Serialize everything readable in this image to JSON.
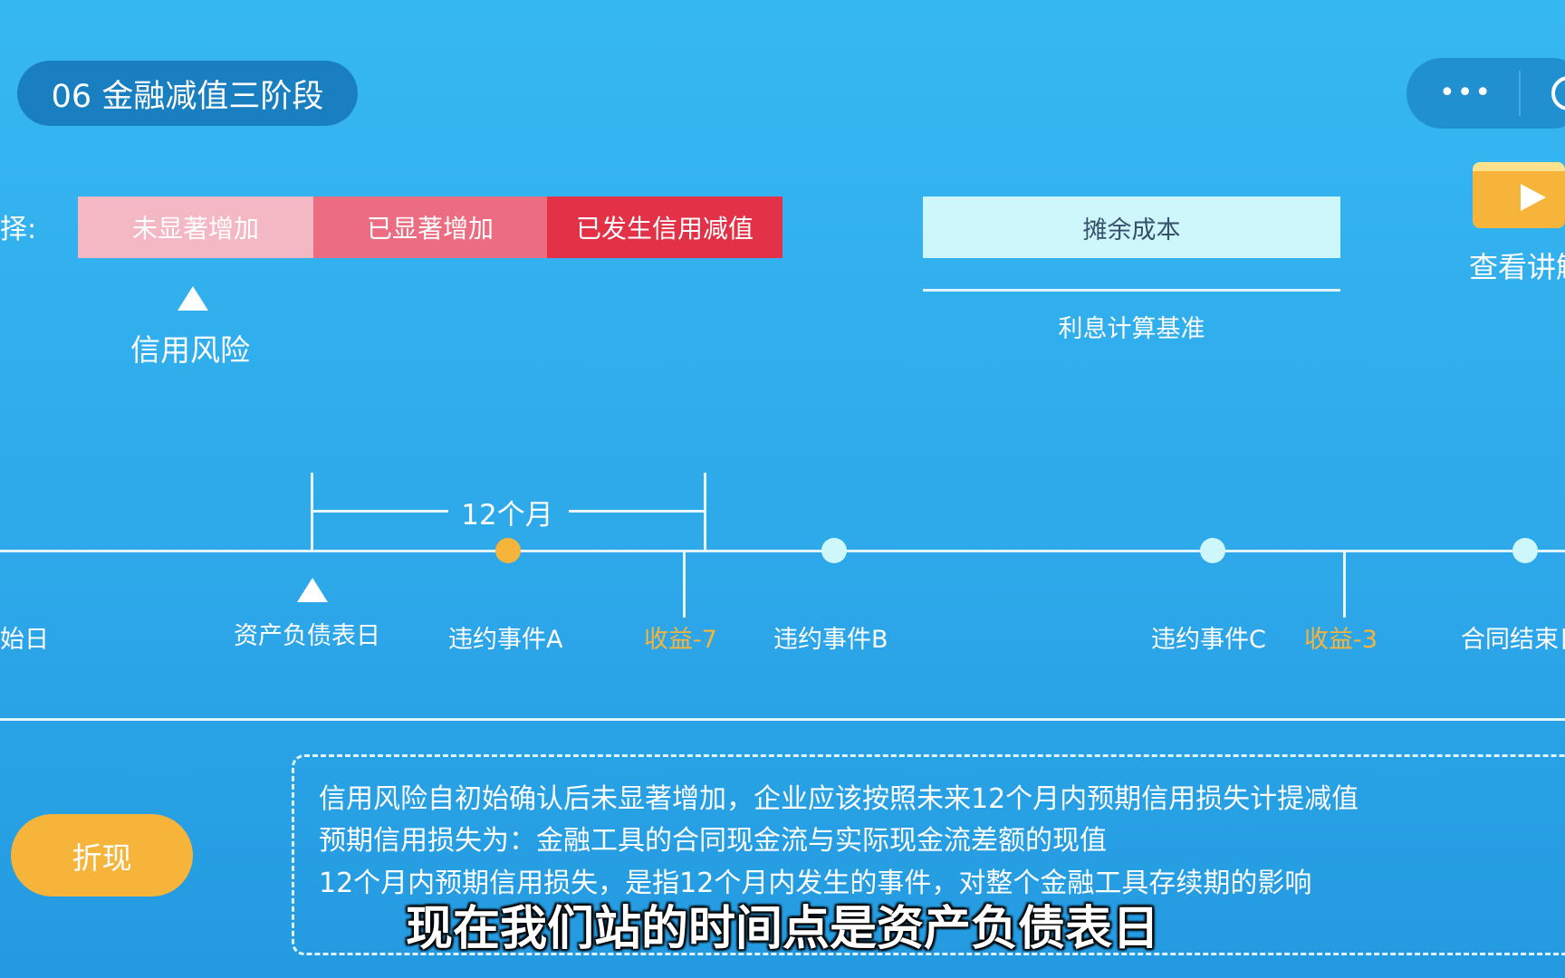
{
  "header": {
    "title": "06 金融减值三阶段"
  },
  "capsule": {
    "dots": "•••"
  },
  "selection": {
    "label": "选择:",
    "stages": [
      "未显著增加",
      "已显著增加",
      "已发生信用减值"
    ]
  },
  "credit_risk_label": "信用风险",
  "amortized": {
    "cost_label": "摊余成本",
    "interest_basis_label": "利息计算基准"
  },
  "video": {
    "label": "查看讲解"
  },
  "timeline": {
    "period_label": "12个月",
    "labels": {
      "start": "初始日",
      "balance_sheet_date": "资产负债表日",
      "default_a": "违约事件A",
      "income_1": "收益-7",
      "default_b": "违约事件B",
      "default_c": "违约事件C",
      "income_2": "收益-3",
      "contract_end": "合同结束日"
    }
  },
  "buttons": {
    "discount": "折现"
  },
  "info": {
    "lines": [
      "信用风险自初始确认后未显著增加，企业应该按照未来12个月内预期信用损失计提减值",
      "预期信用损失为：金融工具的合同现金流与实际现金流差额的现值",
      "12个月内预期信用损失，是指12个月内发生的事件，对整个金融工具存续期的影响"
    ]
  },
  "subtitle": "现在我们站的时间点是资产负债表日",
  "colors": {
    "stage_not_significant": "#f4b8c4",
    "stage_significant": "#ec6c82",
    "stage_impaired": "#e33147",
    "accent_orange": "#f6b43b",
    "amortized_fill": "#cdf7fb"
  }
}
